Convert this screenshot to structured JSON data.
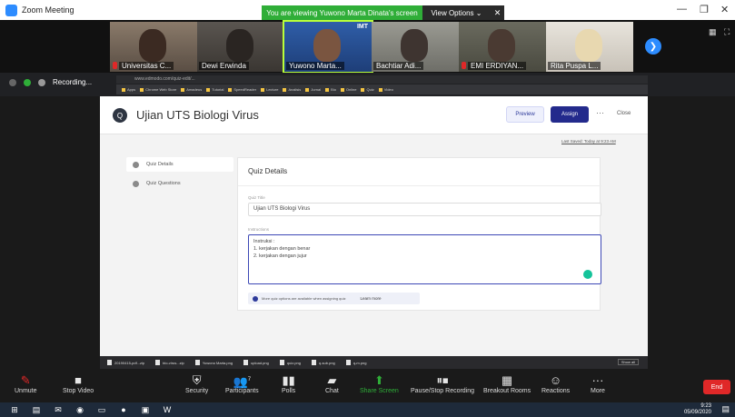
{
  "window": {
    "title": "Zoom Meeting",
    "viewing_banner": "You are viewing Yuwono Marta Dinata's screen",
    "view_options": "View Options ⌄",
    "close_share": "✕",
    "minimize": "—",
    "restore": "❐",
    "close": "✕"
  },
  "participants": [
    {
      "name": "Universitas C..."
    },
    {
      "name": "Dewi Erwinda"
    },
    {
      "name": "Yuwono Marta..."
    },
    {
      "name": "Bachtiar Adi..."
    },
    {
      "name": "EMI ERDIYAN..."
    },
    {
      "name": "Rita Puspa L..."
    }
  ],
  "active_speaker_badge": "IMT",
  "browser": {
    "recording_label": "Recording...",
    "url": "www.edmodo.com/quiz-edit/...",
    "bookmarks": [
      "Apps",
      "Chrome Web Store",
      "Amadeus",
      "Tutorial",
      "SpeedReader",
      "Lecture",
      "Analisis",
      "Jurnal",
      "Bio",
      "Online",
      "Quiz",
      "Video"
    ]
  },
  "quiz": {
    "logo": "Q",
    "title": "Ujian UTS Biologi Virus",
    "preview": "Preview",
    "assign": "Assign",
    "more": "···",
    "close": "Close",
    "last_saved": "Last Saved: Today at 9:23 AM",
    "nav": [
      {
        "label": "Quiz Details"
      },
      {
        "label": "Quiz Questions"
      }
    ],
    "card_title": "Quiz Details",
    "quiz_title_label": "Quiz Title",
    "quiz_title_value": "Ujian UTS Biologi Virus",
    "instructions_label": "Instructions",
    "instructions": [
      "Instruksi :",
      "1. kerjakan dengan benar",
      "2. kerjakan dengan jujur"
    ],
    "info_text": "More quiz options are available when assigning quiz",
    "learn_more": "Learn more"
  },
  "downloads": {
    "items": [
      "20190415-pdf...zip",
      "bio-virus...zip",
      "Yuwono Marta.png",
      "upload.png",
      "quiz.png",
      "q-sub.png",
      "q-m.png"
    ],
    "show_all": "Show all"
  },
  "toolbar": {
    "unmute": "Unmute",
    "stop_video": "Stop Video",
    "security": "Security",
    "participants": "Participants",
    "participants_count": "7",
    "polls": "Polls",
    "chat": "Chat",
    "share_screen": "Share Screen",
    "pause_recording": "Pause/Stop Recording",
    "breakout_rooms": "Breakout Rooms",
    "reactions": "Reactions",
    "more": "More",
    "end": "End"
  },
  "taskbar": {
    "time": "9:23",
    "date": "05/09/2020"
  }
}
